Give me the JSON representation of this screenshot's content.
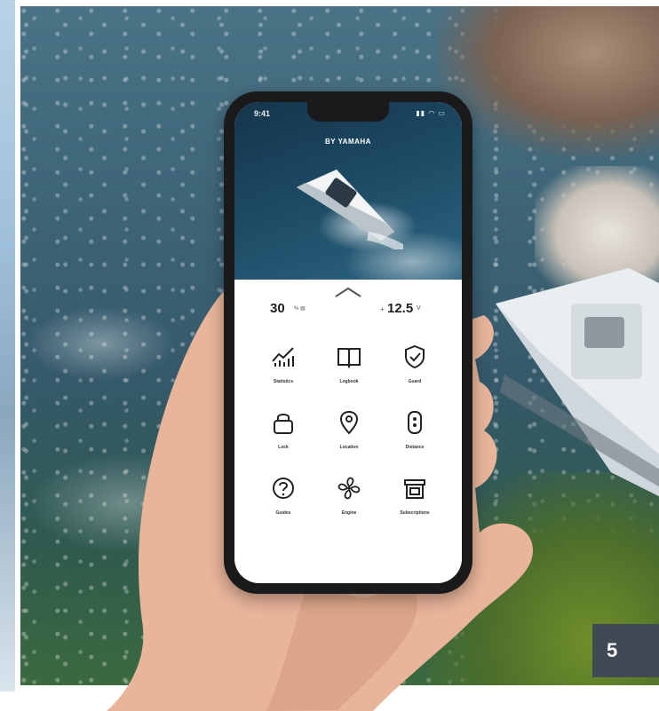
{
  "phone": {
    "status_time": "9:41",
    "status_icons": "▮▮ ◠ ▭",
    "brand": "BY YAMAHA",
    "stats": {
      "left_value": "30",
      "left_unit": "% ▤",
      "right_prefix": "+",
      "right_value": "12.5",
      "right_unit": "V"
    },
    "menu": [
      {
        "label": "Statistics",
        "icon": "statistics-icon"
      },
      {
        "label": "Logbook",
        "icon": "logbook-icon"
      },
      {
        "label": "Guard",
        "icon": "guard-icon"
      },
      {
        "label": "Lock",
        "icon": "lock-icon"
      },
      {
        "label": "Location",
        "icon": "location-icon"
      },
      {
        "label": "Distance",
        "icon": "remote-icon"
      },
      {
        "label": "Guides",
        "icon": "help-icon"
      },
      {
        "label": "Engine",
        "icon": "propeller-icon"
      },
      {
        "label": "Subscriptions",
        "icon": "store-icon"
      }
    ]
  },
  "page_number": "5"
}
